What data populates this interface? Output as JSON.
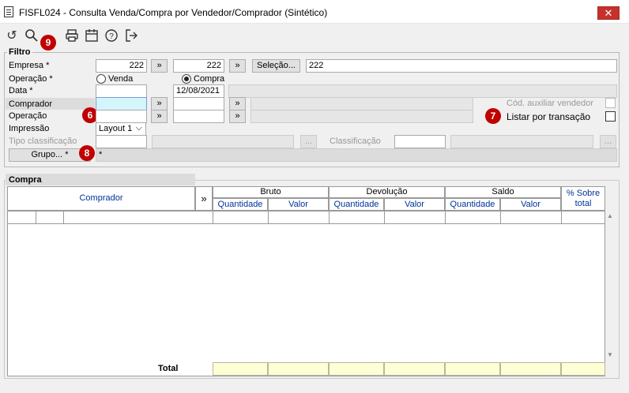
{
  "window": {
    "title": "FISFL024 - Consulta Venda/Compra por Vendedor/Comprador (Sintético)",
    "close_glyph": "✕"
  },
  "toolbar": {
    "icons": [
      "undo-icon",
      "search-icon",
      "print-icon",
      "calendar-icon",
      "help-icon",
      "exit-icon"
    ],
    "glyphs": {
      "undo": "↺",
      "search": "🔍",
      "print": "🖶",
      "calendar": "▦",
      "help": "?",
      "exit": "⇥"
    }
  },
  "annotations": {
    "b9": "9",
    "b6": "6",
    "b7": "7",
    "b8": "8"
  },
  "filtro": {
    "legend": "Filtro",
    "empresa_label": "Empresa *",
    "empresa_from": "222",
    "empresa_to": "222",
    "arrow": "»",
    "selecao_label": "Seleção...",
    "selecao_value": "222",
    "operacao_label": "Operação *",
    "opt_venda": "Venda",
    "opt_compra": "Compra",
    "selected": "Compra",
    "data_label": "Data *",
    "data_from": "",
    "data_to": "12/08/2021",
    "comprador_label": "Comprador",
    "cod_aux_label": "Cód. auxiliar vendedor",
    "operacao2_label": "Operação",
    "listar_label": "Listar por transação",
    "impressao_label": "Impressão",
    "impressao_value": "Layout 1",
    "tipo_class_label": "Tipo classificação",
    "classificacao_label": "Classificação",
    "dots": "...",
    "grupo_label": "Grupo... *",
    "grupo_value": "*"
  },
  "compra": {
    "legend": "Compra",
    "col_comprador": "Comprador",
    "expand": "»",
    "groups": [
      "Bruto",
      "Devolução",
      "Saldo"
    ],
    "sub": [
      "Quantidade",
      "Valor",
      "Quantidade",
      "Valor",
      "Quantidade",
      "Valor"
    ],
    "pct": "% Sobre total",
    "total_label": "Total"
  }
}
